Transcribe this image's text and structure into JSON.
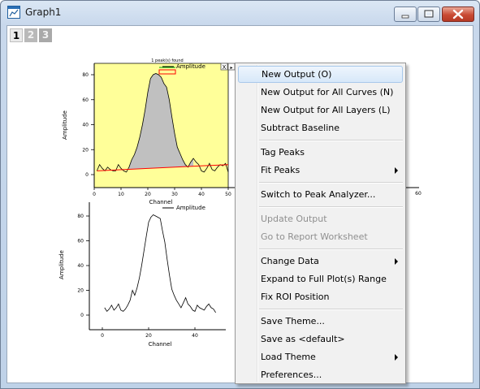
{
  "window": {
    "title": "Graph1",
    "icon": "graph-window-icon"
  },
  "layer_tabs": [
    "1",
    "2",
    "3"
  ],
  "graph_top": {
    "status_label": "1 peak(s) found",
    "legend": "Amplitude",
    "xlabel": "Channel",
    "ylabel": "Amplitude",
    "x_ticks": [
      "0",
      "10",
      "20",
      "30",
      "40",
      "50"
    ],
    "y_ticks": [
      "0",
      "20",
      "40",
      "60",
      "80"
    ],
    "x_tick_partial": "60",
    "roi_close_label": "X",
    "roi_menu_label": "▸",
    "background_color": "#ffff99",
    "fill_color": "#c0c0c0",
    "baseline_color": "#ff0000"
  },
  "graph_bottom": {
    "legend": "Amplitude",
    "xlabel": "Channel",
    "ylabel": "Amplitude",
    "x_ticks": [
      "0",
      "20",
      "40"
    ],
    "y_ticks": [
      "0",
      "20",
      "40",
      "60",
      "80"
    ]
  },
  "chart_data": [
    {
      "type": "area",
      "xlabel": "Channel",
      "ylabel": "Amplitude",
      "xlim": [
        0,
        50
      ],
      "ylim": [
        -5,
        90
      ],
      "series": [
        {
          "name": "Amplitude",
          "x": [
            1,
            2,
            3,
            4,
            5,
            6,
            7,
            8,
            9,
            10,
            11,
            12,
            13,
            14,
            15,
            16,
            17,
            18,
            19,
            20,
            21,
            22,
            23,
            24,
            25,
            26,
            27,
            28,
            29,
            30,
            31,
            32,
            33,
            34,
            35,
            36,
            37,
            38,
            39,
            40,
            41,
            42,
            43,
            44,
            45,
            46,
            47,
            48,
            49,
            50
          ],
          "values": [
            3,
            8,
            5,
            3,
            6,
            4,
            3,
            3,
            8,
            5,
            3,
            2,
            6,
            12,
            16,
            22,
            30,
            40,
            52,
            66,
            77,
            80,
            81,
            80,
            78,
            73,
            70,
            60,
            46,
            33,
            22,
            17,
            12,
            8,
            6,
            10,
            13,
            10,
            8,
            3,
            2,
            5,
            9,
            4,
            3,
            6,
            8,
            7,
            9,
            2
          ]
        }
      ],
      "baseline": {
        "x": [
          1,
          50
        ],
        "y": [
          3,
          8
        ]
      },
      "peaks_found": 1
    },
    {
      "type": "line",
      "xlabel": "Channel",
      "ylabel": "Amplitude",
      "xlim": [
        -5,
        55
      ],
      "ylim": [
        -5,
        85
      ],
      "series": [
        {
          "name": "Amplitude",
          "x": [
            1,
            2,
            3,
            4,
            5,
            6,
            7,
            8,
            9,
            10,
            11,
            12,
            13,
            14,
            15,
            16,
            17,
            18,
            19,
            20,
            21,
            22,
            23,
            24,
            25,
            26,
            27,
            28,
            29,
            30,
            31,
            32,
            33,
            34,
            35,
            36,
            37,
            38,
            39,
            40,
            41,
            42,
            43,
            44,
            45,
            46,
            47,
            48,
            49
          ],
          "values": [
            6,
            3,
            5,
            8,
            4,
            6,
            9,
            4,
            3,
            5,
            8,
            12,
            20,
            16,
            22,
            30,
            40,
            52,
            64,
            75,
            79,
            81,
            80,
            79,
            78,
            68,
            59,
            45,
            32,
            21,
            16,
            12,
            9,
            6,
            10,
            14,
            9,
            7,
            4,
            3,
            8,
            6,
            5,
            4,
            7,
            9,
            6,
            5,
            2
          ]
        }
      ]
    }
  ],
  "context_menu": {
    "items": [
      {
        "label": "New Output (O)",
        "highlighted": true
      },
      {
        "label": "New Output for All Curves (N)"
      },
      {
        "label": "New Output for All Layers (L)"
      },
      {
        "label": "Subtract Baseline"
      },
      {
        "label": "Tag Peaks"
      },
      {
        "label": "Fit Peaks",
        "submenu": true
      },
      {
        "label": "Switch to Peak Analyzer..."
      },
      {
        "label": "Update Output",
        "disabled": true
      },
      {
        "label": "Go to Report Worksheet",
        "disabled": true
      },
      {
        "label": "Change Data",
        "submenu": true
      },
      {
        "label": "Expand to Full Plot(s) Range"
      },
      {
        "label": "Fix ROI Position"
      },
      {
        "label": "Save Theme..."
      },
      {
        "label": "Save as <default>"
      },
      {
        "label": "Load Theme",
        "submenu": true
      },
      {
        "label": "Preferences..."
      }
    ]
  }
}
